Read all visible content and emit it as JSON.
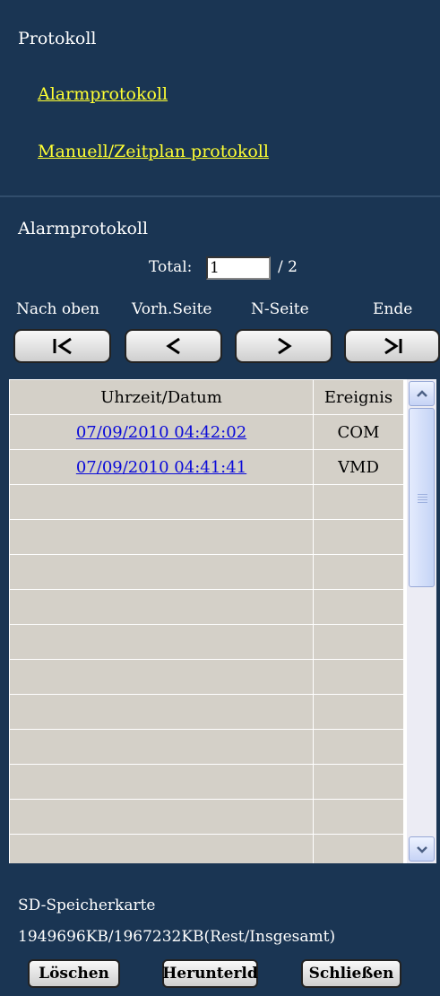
{
  "menu": {
    "title": "Protokoll",
    "links": [
      "Alarmprotokoll",
      "Manuell/Zeitplan protokoll"
    ]
  },
  "log": {
    "title": "Alarmprotokoll",
    "total_label": "Total:",
    "current_page": "1",
    "page_suffix": "/ 2",
    "nav_labels": [
      "Nach oben",
      "Vorh.Seite",
      "N-Seite",
      "Ende"
    ],
    "nav_icons": [
      "first-page-icon",
      "previous-page-icon",
      "next-page-icon",
      "last-page-icon"
    ]
  },
  "table": {
    "headers": [
      "Uhrzeit/Datum",
      "Ereignis"
    ],
    "rows": [
      {
        "datetime": "07/09/2010 04:42:02",
        "event": "COM"
      },
      {
        "datetime": "07/09/2010 04:41:41",
        "event": "VMD"
      }
    ],
    "empty_rows": 11
  },
  "sd": {
    "title": "SD-Speicherkarte",
    "capacity": "1949696KB/1967232KB(Rest/Insgesamt)"
  },
  "buttons": {
    "delete": "Löschen",
    "download": "Herunterld",
    "close": "Schließen"
  },
  "colors": {
    "background": "#1a3553",
    "link": "#ffff33",
    "table_link": "#0a0ad8"
  }
}
